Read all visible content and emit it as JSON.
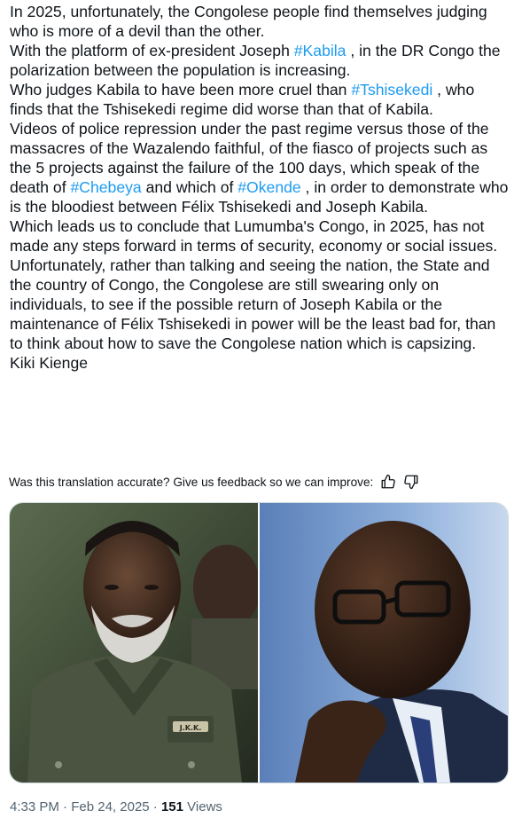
{
  "tweet": {
    "paragraphs": [
      [
        {
          "t": "In 2025, unfortunately, the Congolese people find themselves judging who is more of a devil than the other."
        }
      ],
      [
        {
          "t": "With the platform of ex-president Joseph "
        },
        {
          "t": "#Kabila",
          "tag": true
        },
        {
          "t": " , in the DR Congo the polarization between the population is increasing."
        }
      ],
      [
        {
          "t": "Who judges Kabila to have been more cruel than "
        },
        {
          "t": "#Tshisekedi",
          "tag": true
        },
        {
          "t": " , who finds that the Tshisekedi regime did worse than that of Kabila."
        }
      ],
      [
        {
          "t": "Videos of police repression under the past regime versus those of the massacres of the Wazalendo faithful, of the fiasco of projects such as the 5 projects against the failure of the 100 days, which speak of the death of "
        },
        {
          "t": "#Chebeya",
          "tag": true
        },
        {
          "t": " and which of "
        },
        {
          "t": "#Okende",
          "tag": true
        },
        {
          "t": " , in order to demonstrate who is the bloodiest between Félix Tshisekedi and Joseph Kabila."
        }
      ],
      [
        {
          "t": "Which leads us to conclude that Lumumba's Congo, in 2025, has not made any steps forward in terms of security, economy or social issues."
        }
      ],
      [
        {
          "t": "Unfortunately, rather than talking and seeing the nation, the State and the country of Congo, the Congolese are still swearing only on individuals, to see if the possible return of Joseph Kabila or the maintenance of Félix Tshisekedi in power will be the least bad for, than to think about how to save the Congolese nation which is capsizing."
        }
      ],
      [
        {
          "t": "Kiki Kienge"
        }
      ]
    ]
  },
  "feedback": {
    "text": "Was this translation accurate? Give us feedback so we can improve:",
    "icons": [
      "thumbs-up-icon",
      "thumbs-down-icon"
    ]
  },
  "media": {
    "photos": [
      "photo-joseph-kabila",
      "photo-felix-tshisekedi"
    ],
    "uniform_patch": "J.K.K."
  },
  "meta": {
    "time": "4:33 PM",
    "separator": "·",
    "date": "Feb 24, 2025",
    "views_count": "151",
    "views_label": "Views"
  },
  "colors": {
    "text": "#0f1419",
    "hashtag": "#1d9bf0",
    "muted": "#536471",
    "border": "#cfd9de"
  }
}
